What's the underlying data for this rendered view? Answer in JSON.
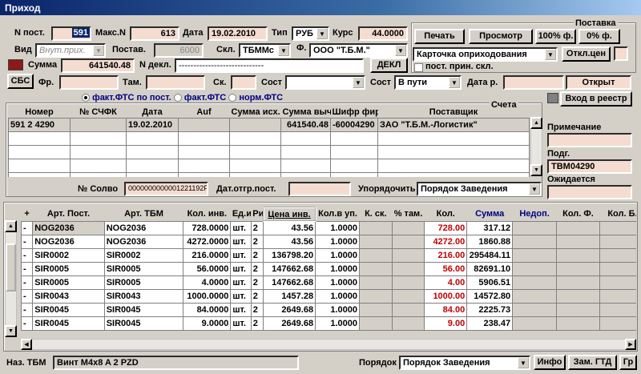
{
  "window": {
    "title": "Приход"
  },
  "header": {
    "n_post_label": "N пост.",
    "n_post_value": "",
    "n_post_sel": "591",
    "maks_n_label": "Макс.N",
    "maks_n_value": "613",
    "data_label": "Дата",
    "data_value": "19.02.2010",
    "tip_label": "Тип",
    "tip_value": "РУБ",
    "kurs_label": "Курс",
    "kurs_value": "44.0000",
    "vid_label": "Вид",
    "vid_value": "Внут.прих.",
    "postav_label": "Постав.",
    "postav_value": "6000",
    "skl_label": "Скл.",
    "skl_value": "ТБММс",
    "f_label": "Ф.",
    "f_value": "ООО \"Т.Б.М.\"",
    "summa_label": "Сумма",
    "summa_value": "641540.48",
    "n_dekl_label": "N декл.",
    "n_dekl_value": "-----------------------------",
    "dekl_button": "ДЕКЛ",
    "sbs_button": "СБС",
    "fr_label": "Фр.",
    "tam_label": "Там.",
    "sk_label": "Ск.",
    "sost_label": "Сост",
    "sost2_label": "Сост",
    "sost2_value": "В пути",
    "data_r_label": "Дата р.",
    "otkryt_value": "Открыт"
  },
  "postavka": {
    "title": "Поставка",
    "pechat": "Печать",
    "prosmotr": "Просмотр",
    "pct100": "100% ф.",
    "pct0": "0% ф.",
    "kartochka": "Карточка оприходования",
    "otkl_cen": "Откл.цен",
    "post_prin_skl": "пост. прин. скл."
  },
  "scheta": {
    "title": "Счета",
    "radio1": "факт.ФТС по пост.",
    "radio2": "факт.ФТС",
    "radio3": "норм.ФТС",
    "columns": [
      "Номер",
      "№ СЧФК",
      "Дата",
      "Auf",
      "Сумма исх.",
      "Сумма выч.",
      "Шифр фир.",
      "Поставщик"
    ],
    "rows": [
      [
        "591 2 4290",
        "",
        "19.02.2010",
        "",
        "",
        "641540.48",
        "-60004290",
        "ЗАО  \"Т.Б.М.-Логистик\""
      ]
    ],
    "n_solvo_label": "№ Солво",
    "n_solvo_value": "000000000000122119​2P",
    "dat_otgr_label": "Дат.отгр.пост.",
    "uporyad_label": "Упорядочить",
    "uporyad_value": "Порядок Заведения"
  },
  "side": {
    "vhod_reestr": "Вход в реестр",
    "primechanie_label": "Примечание",
    "podg_label": "Подг.",
    "podg_value": "ТВМ04290",
    "ozhidaetsya_label": "Ожидается"
  },
  "items": {
    "columns": [
      "+",
      "Арт. Пост.",
      "Арт. ТБМ",
      "Кол. инв.",
      "Ед.и",
      "Ри",
      "Цена инв.",
      "Кол.в уп.",
      "К. ск.",
      "% там.",
      "Кол.",
      "Сумма",
      "Недоп.",
      "Кол. Ф.",
      "Кол. Б."
    ],
    "rows": [
      [
        "-",
        "NOG2036",
        "NOG2036",
        "728.0000",
        "шт.",
        "2",
        "43.56",
        "1.0000",
        "",
        "",
        "728.00",
        "317.12"
      ],
      [
        "-",
        "NOG2036",
        "NOG2036",
        "4272.0000",
        "шт.",
        "2",
        "43.56",
        "1.0000",
        "",
        "",
        "4272.00",
        "1860.88"
      ],
      [
        "-",
        "SIR0002",
        "SIR0002",
        "216.0000",
        "шт.",
        "2",
        "136798.20",
        "1.0000",
        "",
        "",
        "216.00",
        "295484.11"
      ],
      [
        "-",
        "SIR0005",
        "SIR0005",
        "56.0000",
        "шт.",
        "2",
        "147662.68",
        "1.0000",
        "",
        "",
        "56.00",
        "82691.10"
      ],
      [
        "-",
        "SIR0005",
        "SIR0005",
        "4.0000",
        "шт.",
        "2",
        "147662.68",
        "1.0000",
        "",
        "",
        "4.00",
        "5906.51"
      ],
      [
        "-",
        "SIR0043",
        "SIR0043",
        "1000.0000",
        "шт.",
        "2",
        "1457.28",
        "1.0000",
        "",
        "",
        "1000.00",
        "14572.80"
      ],
      [
        "-",
        "SIR0045",
        "SIR0045",
        "84.0000",
        "шт.",
        "2",
        "2649.68",
        "1.0000",
        "",
        "",
        "84.00",
        "2225.73"
      ],
      [
        "-",
        "SIR0045",
        "SIR0045",
        "9.0000",
        "шт.",
        "2",
        "2649.68",
        "1.0000",
        "",
        "",
        "9.00",
        "238.47"
      ]
    ]
  },
  "footer": {
    "naz_tbm_label": "Наз. ТБМ",
    "naz_tbm_value": "Винт M4x8 A 2 PZD",
    "poryadok_label": "Порядок",
    "poryadok_value": "Порядок Заведения",
    "info": "Инфо",
    "zam_gtd": "Зам. ГТД",
    "gr": "Гр"
  },
  "colors": {
    "pink": "#f4dcd0",
    "title": "#0a246a",
    "red_text": "#c00000",
    "blue_header": "#000080"
  }
}
